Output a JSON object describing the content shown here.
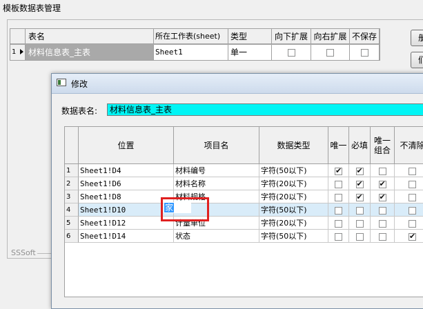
{
  "window": {
    "title": "模板数据表管理"
  },
  "top_table": {
    "headers": [
      "表名",
      "所在工作表(sheet)",
      "类型",
      "向下扩展",
      "向右扩展",
      "不保存"
    ],
    "rows": [
      {
        "num": "1",
        "name": "材料信息表_主表",
        "sheet": "Sheet1",
        "type": "单一",
        "down": false,
        "right": false,
        "nosave": false
      }
    ]
  },
  "side_buttons": [
    "册",
    "们"
  ],
  "footer_label": "SSSoft",
  "dialog": {
    "title": "修改",
    "table_name_label": "数据表名:",
    "table_name_value": "材料信息表_主表",
    "headers": [
      "位置",
      "项目名",
      "数据类型",
      "唯一",
      "必填",
      "唯一\n组合",
      "不清除"
    ],
    "rows": [
      {
        "num": "1",
        "pos": "Sheet1!D4",
        "item": "材料编号",
        "dtype": "字符(50以下)",
        "unique": true,
        "required": true,
        "combo": false,
        "noclear": false
      },
      {
        "num": "2",
        "pos": "Sheet1!D6",
        "item": "材料名称",
        "dtype": "字符(20以下)",
        "unique": false,
        "required": true,
        "combo": true,
        "noclear": false
      },
      {
        "num": "3",
        "pos": "Sheet1!D8",
        "item": "材料规格",
        "dtype": "字符(20以下)",
        "unique": false,
        "required": true,
        "combo": true,
        "noclear": false
      },
      {
        "num": "4",
        "pos": "Sheet1!D10",
        "item": "家",
        "dtype": "字符(50以下)",
        "unique": false,
        "required": false,
        "combo": false,
        "noclear": false
      },
      {
        "num": "5",
        "pos": "Sheet1!D12",
        "item": "计量单位",
        "dtype": "字符(20以下)",
        "unique": false,
        "required": false,
        "combo": false,
        "noclear": false
      },
      {
        "num": "6",
        "pos": "Sheet1!D14",
        "item": "状态",
        "dtype": "字符(50以下)",
        "unique": false,
        "required": false,
        "combo": false,
        "noclear": true
      }
    ],
    "selected_row": 4
  },
  "colors": {
    "accent": "#00f5f5",
    "selection": "#3399ff",
    "highlight_box": "#e02020"
  }
}
